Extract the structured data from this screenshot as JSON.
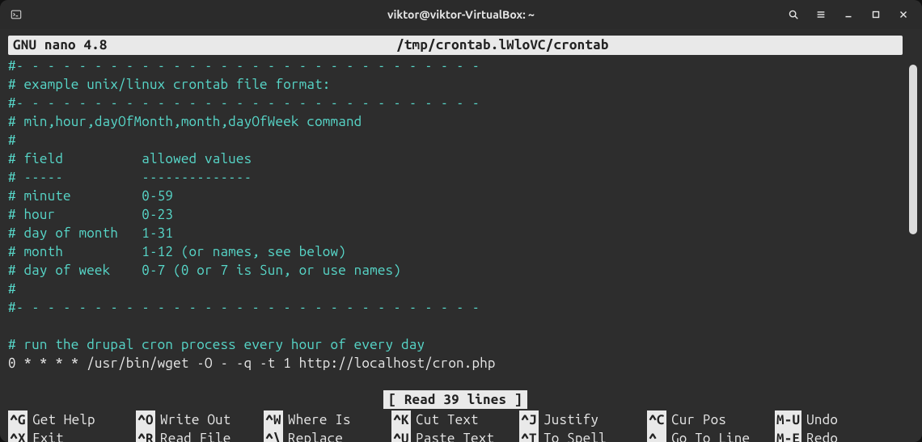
{
  "window": {
    "title": "viktor@viktor-VirtualBox: ~"
  },
  "nano": {
    "version": "GNU  nano  4.8",
    "file": "/tmp/crontab.lWloVC/crontab"
  },
  "lines": [
    {
      "cls": "cyan",
      "text": "#- - - - - - - - - - - - - - - - - - - - - - - - - - - - - -"
    },
    {
      "cls": "cyan",
      "text": "# example unix/linux crontab file format:"
    },
    {
      "cls": "cyan",
      "text": "#- - - - - - - - - - - - - - - - - - - - - - - - - - - - - -"
    },
    {
      "cls": "cyan",
      "text": "# min,hour,dayOfMonth,month,dayOfWeek command"
    },
    {
      "cls": "cyan",
      "text": "#"
    },
    {
      "cls": "cyan",
      "text": "# field          allowed values"
    },
    {
      "cls": "cyan",
      "text": "# -----          --------------"
    },
    {
      "cls": "cyan",
      "text": "# minute         0-59"
    },
    {
      "cls": "cyan",
      "text": "# hour           0-23"
    },
    {
      "cls": "cyan",
      "text": "# day of month   1-31"
    },
    {
      "cls": "cyan",
      "text": "# month          1-12 (or names, see below)"
    },
    {
      "cls": "cyan",
      "text": "# day of week    0-7 (0 or 7 is Sun, or use names)"
    },
    {
      "cls": "cyan",
      "text": "#"
    },
    {
      "cls": "cyan",
      "text": "#- - - - - - - - - - - - - - - - - - - - - - - - - - - - - -"
    },
    {
      "cls": "cyan",
      "text": ""
    },
    {
      "cls": "cyan",
      "text": "# run the drupal cron process every hour of every day"
    },
    {
      "cls": "whitetxt",
      "text": "0 * * * * /usr/bin/wget -O - -q -t 1 http://localhost/cron.php"
    }
  ],
  "status": "[ Read 39 lines ]",
  "shortcuts": {
    "row1": [
      {
        "k": "^G",
        "l": "Get Help"
      },
      {
        "k": "^O",
        "l": "Write Out"
      },
      {
        "k": "^W",
        "l": "Where Is"
      },
      {
        "k": "^K",
        "l": "Cut Text"
      },
      {
        "k": "^J",
        "l": "Justify"
      },
      {
        "k": "^C",
        "l": "Cur Pos"
      },
      {
        "k": "M-U",
        "l": "Undo"
      }
    ],
    "row2": [
      {
        "k": "^X",
        "l": "Exit"
      },
      {
        "k": "^R",
        "l": "Read File"
      },
      {
        "k": "^\\",
        "l": "Replace"
      },
      {
        "k": "^U",
        "l": "Paste Text"
      },
      {
        "k": "^T",
        "l": "To Spell"
      },
      {
        "k": "^_",
        "l": "Go To Line"
      },
      {
        "k": "M-E",
        "l": "Redo"
      }
    ]
  }
}
